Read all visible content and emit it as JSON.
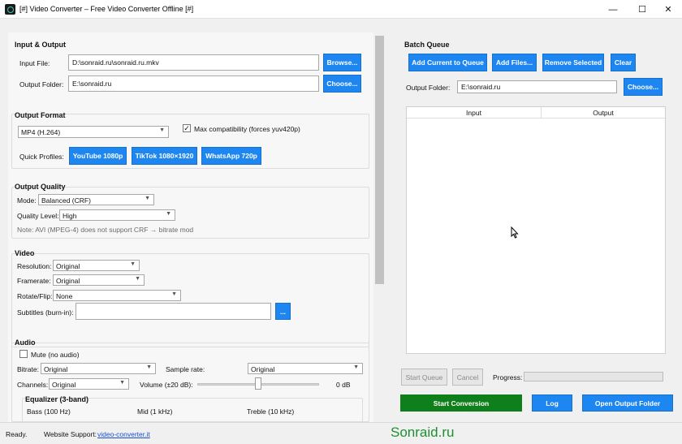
{
  "window": {
    "title": "[#] Video Converter – Free Video Converter Offline [#]",
    "minimize": "—",
    "maximize": "☐",
    "close": "✕"
  },
  "io": {
    "title": "Input & Output",
    "input_label": "Input File:",
    "input_value": "D:\\sonraid.ru\\sonraid.ru.mkv",
    "browse": "Browse...",
    "output_label": "Output Folder:",
    "output_value": "E:\\sonraid.ru",
    "choose": "Choose..."
  },
  "format": {
    "title": "Output Format",
    "selected": "MP4 (H.264)",
    "maxcompat_label": "Max compatibility (forces yuv420p)",
    "maxcompat_checked": true,
    "profiles_label": "Quick Profiles:",
    "profiles": [
      "YouTube 1080p",
      "TikTok 1080×1920",
      "WhatsApp 720p"
    ]
  },
  "quality": {
    "title": "Output Quality",
    "mode_label": "Mode:",
    "mode_value": "Balanced (CRF)",
    "level_label": "Quality Level:",
    "level_value": "High",
    "note": "Note: AVI (MPEG-4) does not support CRF → bitrate mod"
  },
  "video": {
    "title": "Video",
    "resolution_label": "Resolution:",
    "resolution_value": "Original",
    "framerate_label": "Framerate:",
    "framerate_value": "Original",
    "rotate_label": "Rotate/Flip:",
    "rotate_value": "None",
    "subtitles_label": "Subtitles (burn-in):",
    "subtitles_value": "",
    "browse": "..."
  },
  "audio": {
    "title": "Audio",
    "mute_label": "Mute (no audio)",
    "mute_checked": false,
    "bitrate_label": "Bitrate:",
    "bitrate_value": "Original",
    "samplerate_label": "Sample rate:",
    "samplerate_value": "Original",
    "channels_label": "Channels:",
    "channels_value": "Original",
    "volume_label": "Volume (±20 dB):",
    "volume_db": 0,
    "volume_text": "0 dB"
  },
  "eq": {
    "title": "Equalizer (3-band)",
    "bands": [
      "Bass (100 Hz)",
      "Mid (1 kHz)",
      "Treble (10 kHz)"
    ]
  },
  "batch": {
    "title": "Batch Queue",
    "add_current": "Add Current to Queue",
    "add_files": "Add Files...",
    "remove": "Remove Selected",
    "clear": "Clear",
    "output_label": "Output Folder:",
    "output_value": "E:\\sonraid.ru",
    "choose": "Choose...",
    "col_input": "Input",
    "col_output": "Output"
  },
  "actions": {
    "start_queue": "Start Queue",
    "cancel": "Cancel",
    "progress_label": "Progress:",
    "progress_value": 0,
    "start_conversion": "Start Conversion",
    "log": "Log",
    "open_folder": "Open Output Folder"
  },
  "status": {
    "ready": "Ready.",
    "support_label": "Website Support:",
    "support_link": "video-converter.it",
    "watermark": "Sonraid.ru"
  },
  "colors": {
    "accent": "#1e86f0",
    "start": "#0f7f1b",
    "watermark": "#1e8f30"
  }
}
